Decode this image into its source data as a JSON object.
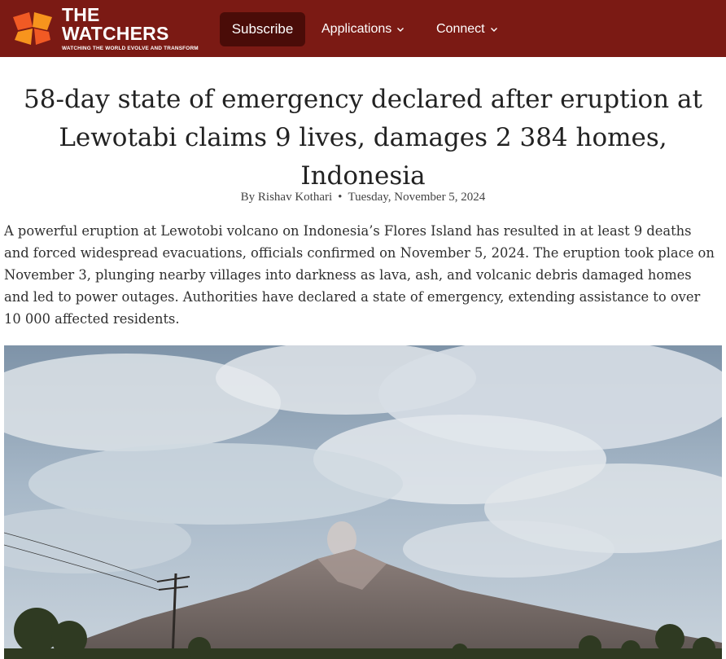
{
  "header": {
    "brand": "THE WATCHERS",
    "tagline": "WATCHING THE WORLD EVOLVE AND TRANSFORM",
    "subscribe_label": "Subscribe",
    "nav": [
      {
        "label": "Applications",
        "icon": "chevron-down-icon"
      },
      {
        "label": "Connect",
        "icon": "chevron-down-icon"
      }
    ],
    "colors": {
      "bar": "#7b1a14",
      "subscribe": "#4a0c08",
      "logo_orange": "#f15a24"
    }
  },
  "article": {
    "title": "58-day state of emergency declared after eruption at Lewotabi claims 9 lives, damages 2 384 homes, Indonesia",
    "author": "By Rishav Kothari",
    "separator": "•",
    "date": "Tuesday, November 5, 2024",
    "lead": "A powerful eruption at Lewotobi volcano on Indonesia’s Flores Island has resulted in at least 9 deaths and forced widespread evacuations, officials confirmed on November 5, 2024. The eruption took place on November 3, plunging nearby villages into darkness as lava, ash, and volcanic debris damaged homes and led to power outages. Authorities have declared a state of emergency, extending assistance to over 10 000 affected residents."
  }
}
